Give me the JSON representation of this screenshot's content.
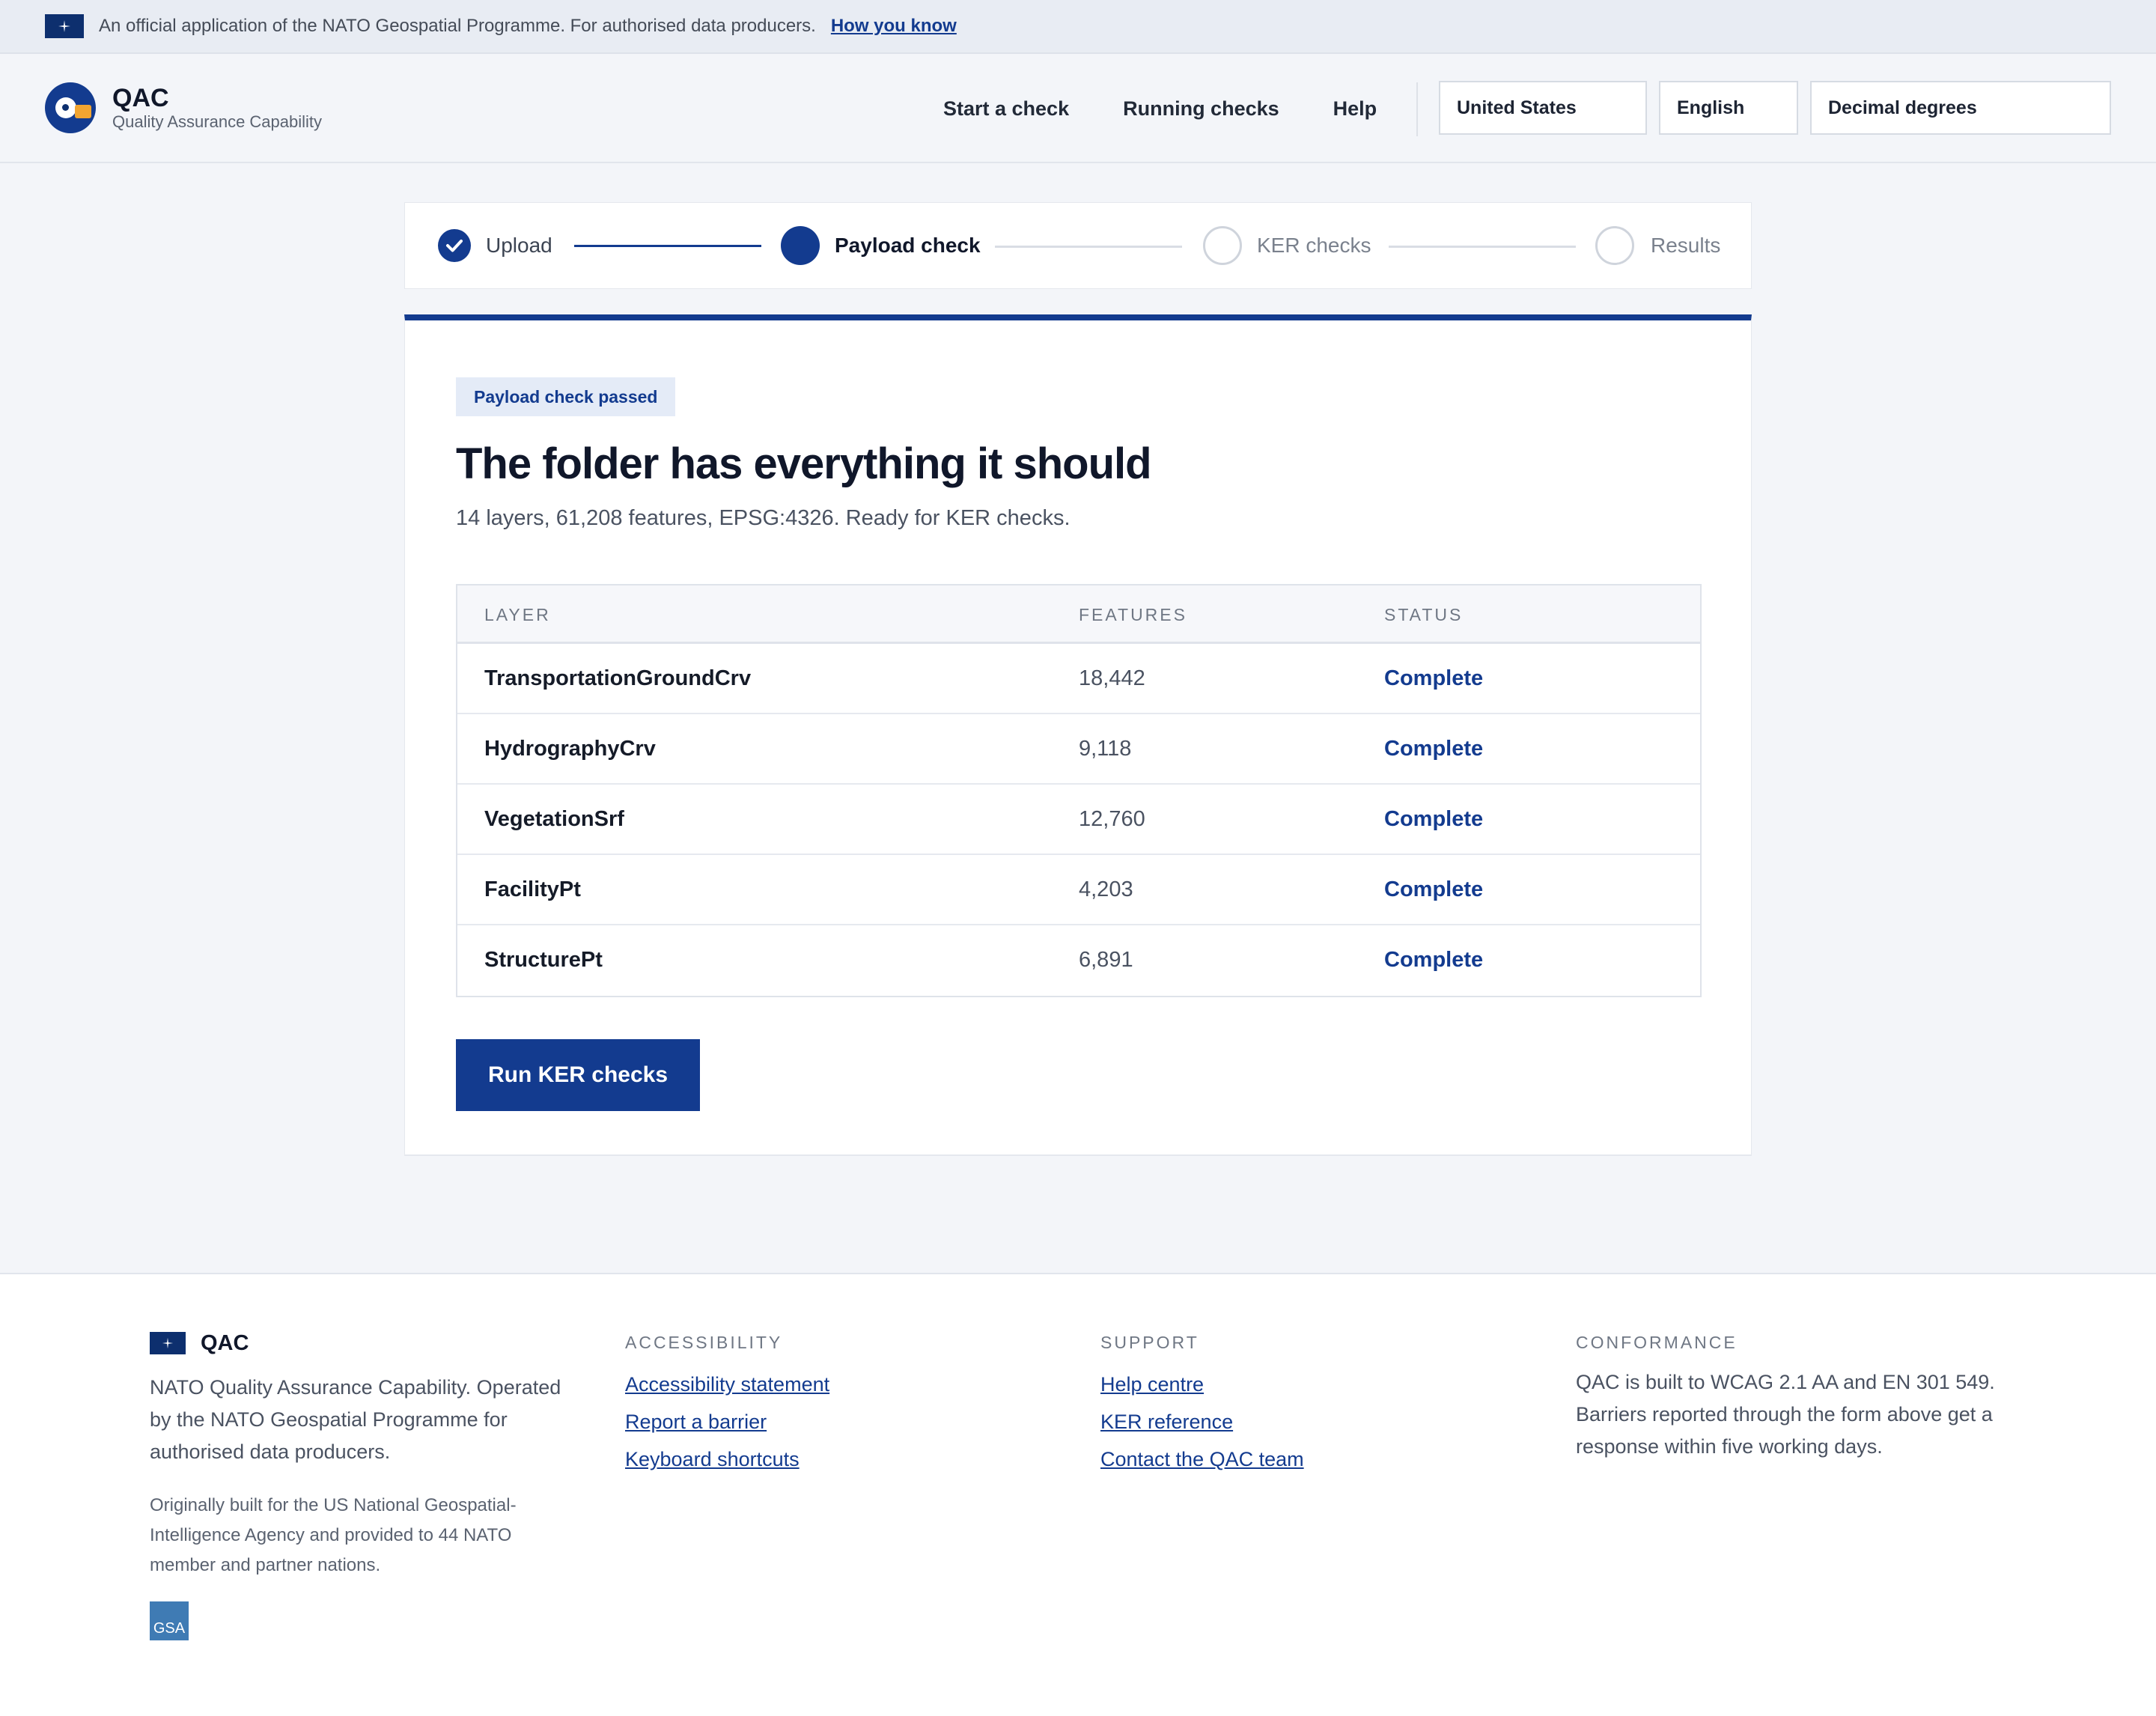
{
  "banner": {
    "text": "An official application of the NATO Geospatial Programme. For authorised data producers.",
    "link": "How you know"
  },
  "brand": {
    "title": "QAC",
    "subtitle": "Quality Assurance Capability"
  },
  "nav": {
    "items": [
      {
        "label": "Start a check"
      },
      {
        "label": "Running checks"
      },
      {
        "label": "Help"
      }
    ]
  },
  "selects": {
    "country": "United States",
    "language": "English",
    "coordinates": "Decimal degrees"
  },
  "stepper": {
    "steps": [
      {
        "label": "Upload",
        "state": "done"
      },
      {
        "label": "Payload check",
        "state": "current"
      },
      {
        "label": "KER checks",
        "state": "todo"
      },
      {
        "label": "Results",
        "state": "todo"
      }
    ]
  },
  "card": {
    "badge": "Payload check passed",
    "title": "The folder has everything it should",
    "subtitle": "14 layers, 61,208 features, EPSG:4326. Ready for KER checks.",
    "table": {
      "headers": [
        "LAYER",
        "FEATURES",
        "STATUS"
      ],
      "rows": [
        {
          "layer": "TransportationGroundCrv",
          "features": "18,442",
          "status": "Complete"
        },
        {
          "layer": "HydrographyCrv",
          "features": "9,118",
          "status": "Complete"
        },
        {
          "layer": "VegetationSrf",
          "features": "12,760",
          "status": "Complete"
        },
        {
          "layer": "FacilityPt",
          "features": "4,203",
          "status": "Complete"
        },
        {
          "layer": "StructurePt",
          "features": "6,891",
          "status": "Complete"
        }
      ]
    },
    "button": "Run KER checks"
  },
  "footer": {
    "brand": "QAC",
    "description": "NATO Quality Assurance Capability. Operated by the NATO Geospatial Programme for authorised data producers.",
    "origin": "Originally built for the US National Geospatial-Intelligence Agency and provided to 44 NATO member and partner nations.",
    "gsa": "GSA",
    "columns": [
      {
        "heading": "ACCESSIBILITY",
        "links": [
          "Accessibility statement",
          "Report a barrier",
          "Keyboard shortcuts"
        ]
      },
      {
        "heading": "SUPPORT",
        "links": [
          "Help centre",
          "KER reference",
          "Contact the QAC team"
        ]
      }
    ],
    "conformance": {
      "heading": "CONFORMANCE",
      "text": "QAC is built to WCAG 2.1 AA and EN 301 549. Barriers reported through the form above get a response within five working days."
    }
  },
  "colors": {
    "primary": "#133b8f",
    "banner_bg": "#e8ecf3",
    "page_bg": "#f3f5f9",
    "accent": "#f2a531"
  }
}
